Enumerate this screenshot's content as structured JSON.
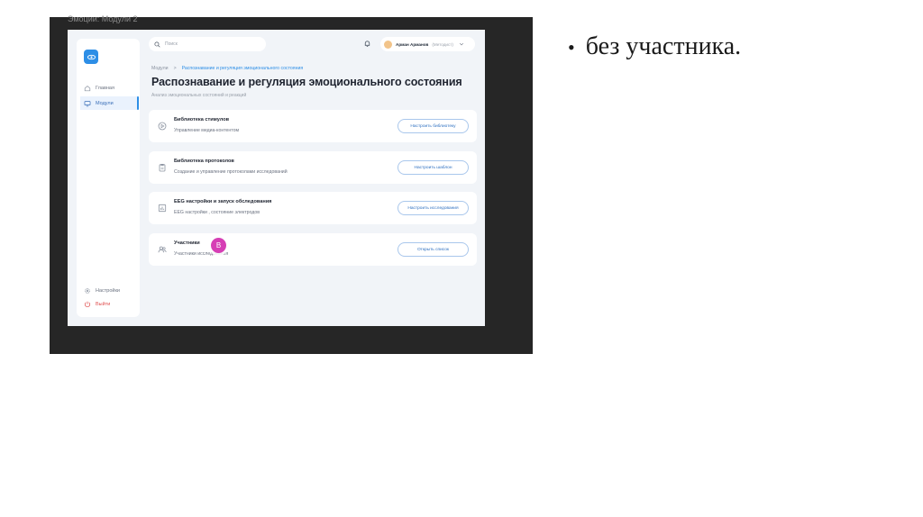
{
  "frame": {
    "title": "Эмоции: Модули 2"
  },
  "sidebar": {
    "items": [
      {
        "label": "Главная",
        "icon": "home-icon"
      },
      {
        "label": "Модули",
        "icon": "monitor-icon"
      },
      {
        "label": "Настройки",
        "icon": "gear-icon"
      },
      {
        "label": "Выйти",
        "icon": "logout-icon"
      }
    ]
  },
  "topbar": {
    "search_placeholder": "Поиск",
    "user_name": "Арман Арманов",
    "user_role": "(Методист)"
  },
  "breadcrumb": {
    "root": "Модули",
    "sep": ">",
    "current": "Распознавание и регуляция эмоционального состояния"
  },
  "page": {
    "title": "Распознавание и регуляция эмоционального состояния",
    "subtitle": "Анализ эмоциональных состояний и реакций"
  },
  "cards": [
    {
      "title": "Библиотека стимулов",
      "desc": "Управление медиа-контентом",
      "button": "Настроить библиотеку",
      "icon": "play-icon"
    },
    {
      "title": "Библиотека протоколов",
      "desc": "Создание и управление протоколами исследований",
      "button": "Настроить шаблон",
      "icon": "clipboard-icon"
    },
    {
      "title": "EEG настройки и запуск обследования",
      "desc": "EEG настройки , состояние электродов",
      "button": "Настроить исследования",
      "icon": "chart-icon"
    },
    {
      "title": "Участники",
      "desc": "Участники исследования",
      "button": "Открыть список",
      "icon": "users-icon"
    }
  ],
  "badge": {
    "letter": "B"
  },
  "slide": {
    "bullet_marker": "•",
    "bullet_text": "без участника."
  },
  "colors": {
    "accent": "#2d8ee6",
    "badge": "#d63fb5",
    "frame_bg": "#262626",
    "app_bg": "#f1f4f8"
  }
}
